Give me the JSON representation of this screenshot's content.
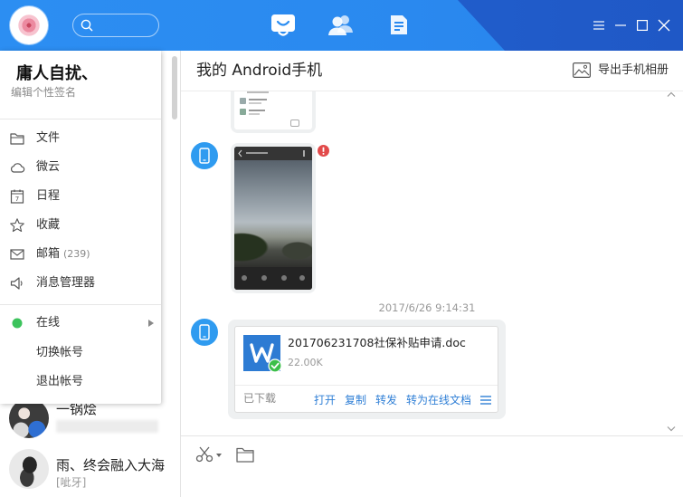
{
  "theme": {
    "topbar": "#2c8ef2",
    "topbar_dark": "#2466d4",
    "link": "#2f7fd6",
    "online": "#3cc35c",
    "error": "#e24a4a",
    "device_avatar": "#2f9bf0",
    "word_blue": "#2d7bd3",
    "check_green": "#3cbf4a"
  },
  "topbar": {
    "search_icon": "search-icon",
    "tabs": [
      {
        "icon": "chat-icon",
        "active": true
      },
      {
        "icon": "contacts-icon",
        "active": false
      },
      {
        "icon": "docs-icon",
        "active": false
      }
    ],
    "controls": [
      "menu-icon",
      "minimize-icon",
      "maximize-icon",
      "close-icon"
    ]
  },
  "profile_menu": {
    "name": "庸人自扰、",
    "signature": "编辑个性签名",
    "items": [
      {
        "icon": "folder-icon",
        "label": "文件"
      },
      {
        "icon": "cloud-icon",
        "label": "微云"
      },
      {
        "icon": "calendar-icon",
        "label": "日程",
        "icon_day": "7"
      },
      {
        "icon": "star-icon",
        "label": "收藏"
      },
      {
        "icon": "mail-icon",
        "label": "邮箱",
        "count": "(239)"
      },
      {
        "icon": "speaker-icon",
        "label": "消息管理器"
      }
    ],
    "status": {
      "icon": "online-dot-icon",
      "label": "在线"
    },
    "switch_account": "切换帐号",
    "logout": "退出帐号"
  },
  "contacts": [
    {
      "name": "一锅烩"
    },
    {
      "name": "雨、终会融入大海",
      "preview": "[呲牙]"
    }
  ],
  "chat": {
    "title": "我的 Android手机",
    "export_label": "导出手机相册",
    "timestamp": "2017/6/26 9:14:31",
    "file": {
      "name": "201706231708社保补贴申请.doc",
      "size": "22.00K",
      "status": "已下载",
      "actions": [
        {
          "label": "打开"
        },
        {
          "label": "复制"
        },
        {
          "label": "转发"
        },
        {
          "label": "转为在线文档"
        }
      ]
    }
  },
  "input_toolbar": {
    "tools": [
      "scissors-icon",
      "folder-icon"
    ]
  }
}
